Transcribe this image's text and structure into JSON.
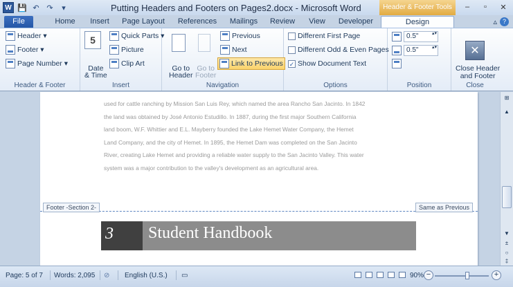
{
  "window": {
    "title": "Putting Headers and Footers on Pages2.docx - Microsoft Word",
    "context_tab": "Header & Footer Tools",
    "controls": {
      "minimize": "–",
      "maximize": "▫",
      "close": "✕"
    }
  },
  "qat": {
    "app_icon": "W",
    "save": "💾",
    "undo": "↶",
    "redo": "↷",
    "customize": "▾"
  },
  "tabs": [
    "File",
    "Home",
    "Insert",
    "Page Layout",
    "References",
    "Mailings",
    "Review",
    "View",
    "Developer",
    "Design"
  ],
  "ribbon": {
    "header_footer": {
      "label": "Header & Footer",
      "header": "Header ▾",
      "footer": "Footer ▾",
      "page_number": "Page Number ▾"
    },
    "insert": {
      "label": "Insert",
      "date_time_1": "Date",
      "date_time_2": "& Time",
      "date_icon_text": "5",
      "quick_parts": "Quick Parts ▾",
      "picture": "Picture",
      "clip_art": "Clip Art"
    },
    "navigation": {
      "label": "Navigation",
      "goto_header_1": "Go to",
      "goto_header_2": "Header",
      "goto_footer_1": "Go to",
      "goto_footer_2": "Footer",
      "previous": "Previous",
      "next": "Next",
      "link_to_previous": "Link to Previous"
    },
    "options": {
      "label": "Options",
      "different_first_page": "Different First Page",
      "different_odd_even": "Different Odd & Even Pages",
      "show_document_text": "Show Document Text"
    },
    "position": {
      "label": "Position",
      "header_from_top": "0.5\"",
      "footer_from_bottom": "0.5\""
    },
    "close": {
      "label": "Close",
      "close_1": "Close Header",
      "close_2": "and Footer"
    }
  },
  "document": {
    "body_lines": [
      "used for cattle ranching by Mission San Luis Rey, which named the area Rancho San Jacinto. In 1842",
      "the land was obtained by José Antonio Estudillo. In 1887, during the first major Southern California",
      "land boom, W.F. Whittier and E.L. Mayberry founded the Lake Hemet Water Company, the Hemet",
      "Land Company, and the city of Hemet. In 1895, the Hemet Dam was completed on the San Jacinto",
      "River, creating Lake Hemet and providing a reliable water supply to the San Jacinto Valley. This water",
      "system was a major contribution to the valley's development as an agricultural area."
    ],
    "footer_tag": "Footer -Section 2-",
    "same_as_previous": "Same as Previous",
    "footer_page_number": "3",
    "footer_title": "Student Handbook"
  },
  "statusbar": {
    "page": "Page: 5 of 7",
    "words": "Words: 2,095",
    "language": "English (U.S.)",
    "zoom": "90%",
    "zoom_level": 0.6
  }
}
